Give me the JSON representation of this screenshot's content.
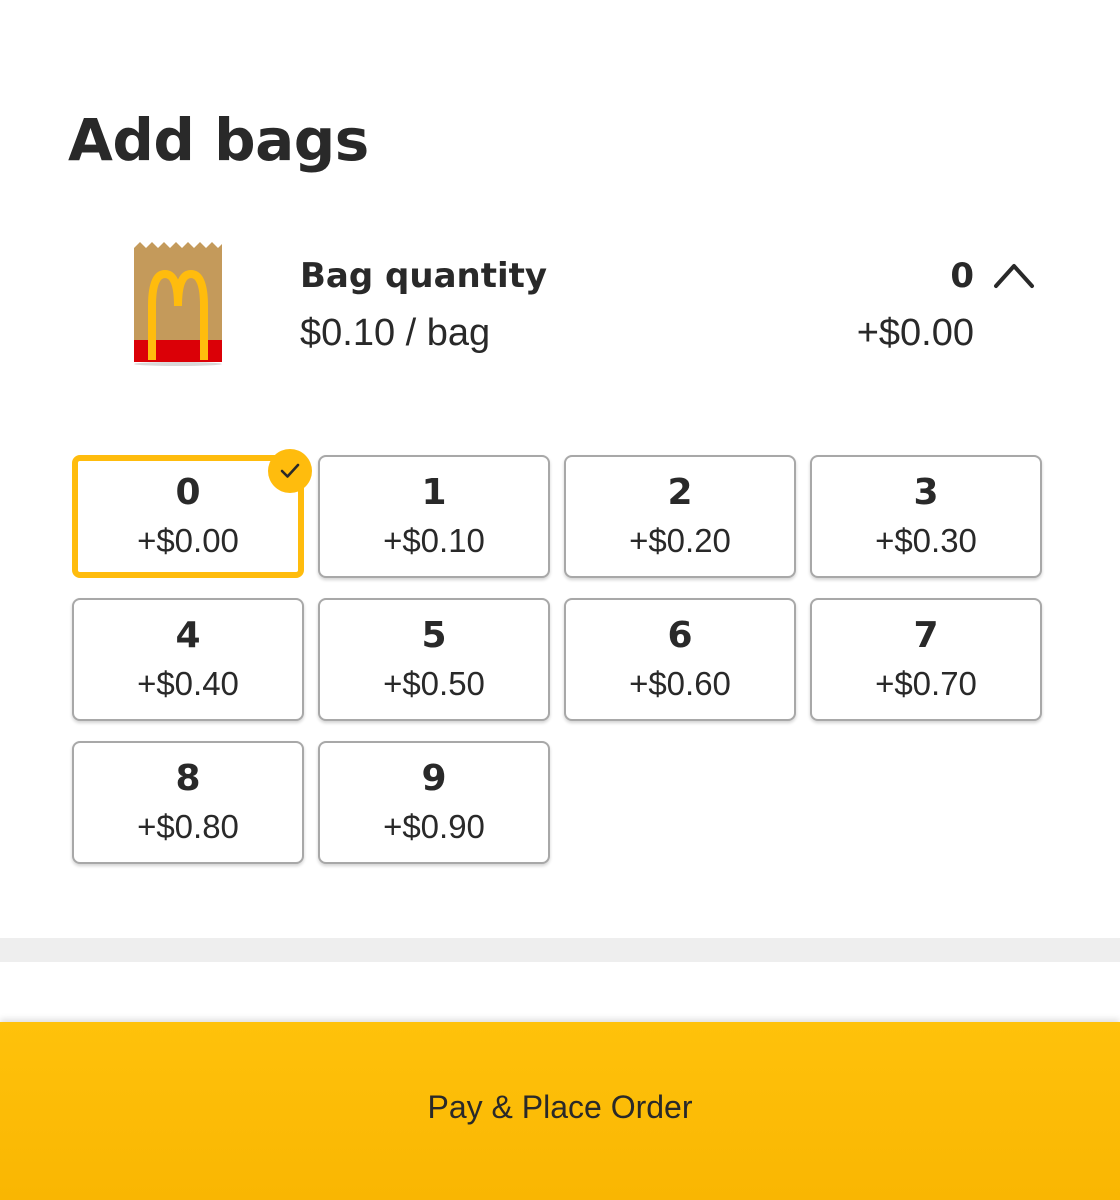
{
  "page": {
    "title": "Add bags"
  },
  "bag": {
    "image_icon": "mcdonalds-bag-icon",
    "title": "Bag quantity",
    "unit_price": "$0.10 / bag",
    "quantity": "0",
    "total": "+$0.00",
    "expand_icon": "chevron-up-icon"
  },
  "options": [
    {
      "num": "0",
      "price": "+$0.00",
      "selected": true
    },
    {
      "num": "1",
      "price": "+$0.10",
      "selected": false
    },
    {
      "num": "2",
      "price": "+$0.20",
      "selected": false
    },
    {
      "num": "3",
      "price": "+$0.30",
      "selected": false
    },
    {
      "num": "4",
      "price": "+$0.40",
      "selected": false
    },
    {
      "num": "5",
      "price": "+$0.50",
      "selected": false
    },
    {
      "num": "6",
      "price": "+$0.60",
      "selected": false
    },
    {
      "num": "7",
      "price": "+$0.70",
      "selected": false
    },
    {
      "num": "8",
      "price": "+$0.80",
      "selected": false
    },
    {
      "num": "9",
      "price": "+$0.90",
      "selected": false
    }
  ],
  "selected_icon": "checkmark-icon",
  "footer": {
    "pay_label": "Pay & Place Order"
  },
  "colors": {
    "accent": "#ffbc0d",
    "text": "#292929",
    "bag_brown": "#c49a5b",
    "bag_red": "#db0007",
    "border": "#a8a8a8"
  }
}
